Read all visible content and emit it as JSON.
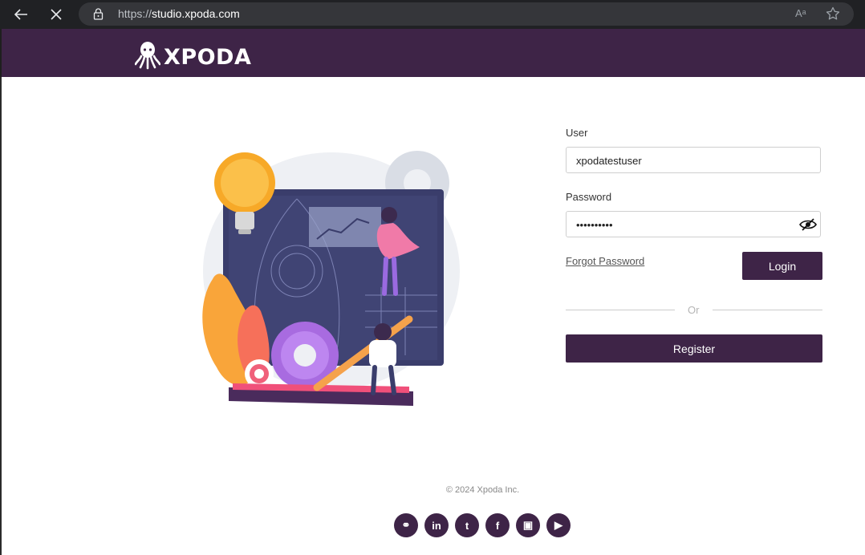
{
  "browser": {
    "url_scheme": "https://",
    "url_host": "studio.xpoda.com",
    "read_aloud_icon": "Aᵃ",
    "icons": [
      "back-arrow-icon",
      "close-icon",
      "lock-icon",
      "read-aloud-icon",
      "favorite-star-icon"
    ]
  },
  "header": {
    "logo_text": "XPODA",
    "logo_icon": "octopus-icon",
    "brand_color": "#3e2447"
  },
  "illustration": {
    "icon": "developer-workspace-illustration"
  },
  "login_form": {
    "user_label": "User",
    "user_value": "xpodatestuser",
    "password_label": "Password",
    "password_value": "••••••••••",
    "password_toggle_icon": "eye-slash-icon",
    "forgot_password": "Forgot Password",
    "login_button": "Login",
    "separator": "Or",
    "register_button": "Register"
  },
  "footer": {
    "copyright": "© 2024 Xpoda Inc.",
    "social_links": [
      {
        "icon": "link-icon",
        "glyph": "⚭"
      },
      {
        "icon": "linkedin-icon",
        "glyph": "in"
      },
      {
        "icon": "twitter-icon",
        "glyph": "t"
      },
      {
        "icon": "facebook-icon",
        "glyph": "f"
      },
      {
        "icon": "instagram-icon",
        "glyph": "▣"
      },
      {
        "icon": "youtube-icon",
        "glyph": "▶"
      }
    ]
  }
}
